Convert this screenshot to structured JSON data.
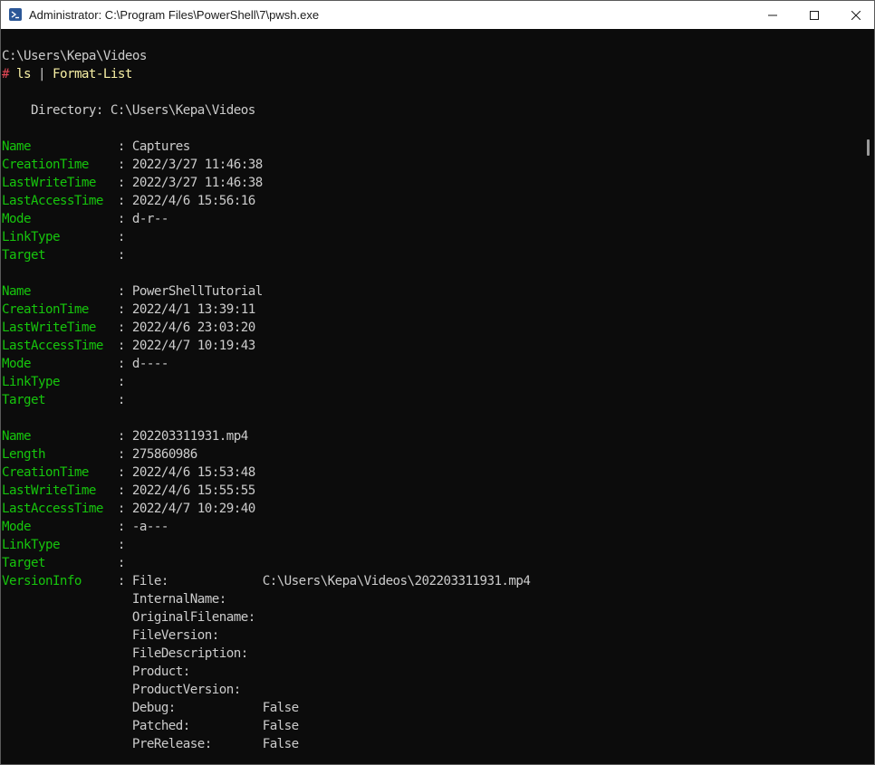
{
  "window": {
    "title": "Administrator: C:\\Program Files\\PowerShell\\7\\pwsh.exe",
    "icon": "powershell-icon",
    "controls": [
      "minimize-icon",
      "maximize-icon",
      "close-icon"
    ]
  },
  "colors": {
    "background": "#0c0c0c",
    "default_text": "#cccccc",
    "property_name": "#16c60c",
    "command": "#f9f1a5",
    "prompt_symbol": "#e74856",
    "titlebar": "#ffffff"
  },
  "terminal": {
    "lines": [
      {
        "row": 0,
        "spans": [
          {
            "t": "C:\\Users\\Kepa\\Videos",
            "c": "default",
            "name": "prompt-path"
          }
        ]
      },
      {
        "row": 1,
        "spans": [
          {
            "t": "#",
            "c": "red",
            "name": "prompt-symbol"
          },
          {
            "t": " ",
            "c": "default",
            "name": "prompt-space"
          },
          {
            "t": "ls",
            "c": "yellow",
            "name": "command-name"
          },
          {
            "t": " | ",
            "c": "default",
            "name": "pipe-operator"
          },
          {
            "t": "Format-List",
            "c": "yellow",
            "name": "command-name"
          }
        ]
      },
      {
        "row": 3,
        "spans": [
          {
            "t": "    Directory: C:\\Users\\Kepa\\Videos",
            "c": "default",
            "name": "directory-header"
          }
        ]
      },
      {
        "row": 5,
        "spans": [
          {
            "t": "Name           ",
            "c": "green",
            "name": "property-key"
          },
          {
            "t": " : ",
            "c": "default",
            "name": "property-separator"
          },
          {
            "t": "Captures",
            "c": "default",
            "name": "property-value"
          }
        ]
      },
      {
        "row": 6,
        "spans": [
          {
            "t": "CreationTime   ",
            "c": "green",
            "name": "property-key"
          },
          {
            "t": " : ",
            "c": "default",
            "name": "property-separator"
          },
          {
            "t": "2022/3/27 11:46:38",
            "c": "default",
            "name": "property-value"
          }
        ]
      },
      {
        "row": 7,
        "spans": [
          {
            "t": "LastWriteTime  ",
            "c": "green",
            "name": "property-key"
          },
          {
            "t": " : ",
            "c": "default",
            "name": "property-separator"
          },
          {
            "t": "2022/3/27 11:46:38",
            "c": "default",
            "name": "property-value"
          }
        ]
      },
      {
        "row": 8,
        "spans": [
          {
            "t": "LastAccessTime ",
            "c": "green",
            "name": "property-key"
          },
          {
            "t": " : ",
            "c": "default",
            "name": "property-separator"
          },
          {
            "t": "2022/4/6 15:56:16",
            "c": "default",
            "name": "property-value"
          }
        ]
      },
      {
        "row": 9,
        "spans": [
          {
            "t": "Mode           ",
            "c": "green",
            "name": "property-key"
          },
          {
            "t": " : ",
            "c": "default",
            "name": "property-separator"
          },
          {
            "t": "d-r--",
            "c": "default",
            "name": "property-value"
          }
        ]
      },
      {
        "row": 10,
        "spans": [
          {
            "t": "LinkType       ",
            "c": "green",
            "name": "property-key"
          },
          {
            "t": " : ",
            "c": "default",
            "name": "property-separator"
          }
        ]
      },
      {
        "row": 11,
        "spans": [
          {
            "t": "Target         ",
            "c": "green",
            "name": "property-key"
          },
          {
            "t": " : ",
            "c": "default",
            "name": "property-separator"
          }
        ]
      },
      {
        "row": 13,
        "spans": [
          {
            "t": "Name           ",
            "c": "green",
            "name": "property-key"
          },
          {
            "t": " : ",
            "c": "default",
            "name": "property-separator"
          },
          {
            "t": "PowerShellTutorial",
            "c": "default",
            "name": "property-value"
          }
        ]
      },
      {
        "row": 14,
        "spans": [
          {
            "t": "CreationTime   ",
            "c": "green",
            "name": "property-key"
          },
          {
            "t": " : ",
            "c": "default",
            "name": "property-separator"
          },
          {
            "t": "2022/4/1 13:39:11",
            "c": "default",
            "name": "property-value"
          }
        ]
      },
      {
        "row": 15,
        "spans": [
          {
            "t": "LastWriteTime  ",
            "c": "green",
            "name": "property-key"
          },
          {
            "t": " : ",
            "c": "default",
            "name": "property-separator"
          },
          {
            "t": "2022/4/6 23:03:20",
            "c": "default",
            "name": "property-value"
          }
        ]
      },
      {
        "row": 16,
        "spans": [
          {
            "t": "LastAccessTime ",
            "c": "green",
            "name": "property-key"
          },
          {
            "t": " : ",
            "c": "default",
            "name": "property-separator"
          },
          {
            "t": "2022/4/7 10:19:43",
            "c": "default",
            "name": "property-value"
          }
        ]
      },
      {
        "row": 17,
        "spans": [
          {
            "t": "Mode           ",
            "c": "green",
            "name": "property-key"
          },
          {
            "t": " : ",
            "c": "default",
            "name": "property-separator"
          },
          {
            "t": "d----",
            "c": "default",
            "name": "property-value"
          }
        ]
      },
      {
        "row": 18,
        "spans": [
          {
            "t": "LinkType       ",
            "c": "green",
            "name": "property-key"
          },
          {
            "t": " : ",
            "c": "default",
            "name": "property-separator"
          }
        ]
      },
      {
        "row": 19,
        "spans": [
          {
            "t": "Target         ",
            "c": "green",
            "name": "property-key"
          },
          {
            "t": " : ",
            "c": "default",
            "name": "property-separator"
          }
        ]
      },
      {
        "row": 21,
        "spans": [
          {
            "t": "Name           ",
            "c": "green",
            "name": "property-key"
          },
          {
            "t": " : ",
            "c": "default",
            "name": "property-separator"
          },
          {
            "t": "202203311931.mp4",
            "c": "default",
            "name": "property-value"
          }
        ]
      },
      {
        "row": 22,
        "spans": [
          {
            "t": "Length         ",
            "c": "green",
            "name": "property-key"
          },
          {
            "t": " : ",
            "c": "default",
            "name": "property-separator"
          },
          {
            "t": "275860986",
            "c": "default",
            "name": "property-value"
          }
        ]
      },
      {
        "row": 23,
        "spans": [
          {
            "t": "CreationTime   ",
            "c": "green",
            "name": "property-key"
          },
          {
            "t": " : ",
            "c": "default",
            "name": "property-separator"
          },
          {
            "t": "2022/4/6 15:53:48",
            "c": "default",
            "name": "property-value"
          }
        ]
      },
      {
        "row": 24,
        "spans": [
          {
            "t": "LastWriteTime  ",
            "c": "green",
            "name": "property-key"
          },
          {
            "t": " : ",
            "c": "default",
            "name": "property-separator"
          },
          {
            "t": "2022/4/6 15:55:55",
            "c": "default",
            "name": "property-value"
          }
        ]
      },
      {
        "row": 25,
        "spans": [
          {
            "t": "LastAccessTime ",
            "c": "green",
            "name": "property-key"
          },
          {
            "t": " : ",
            "c": "default",
            "name": "property-separator"
          },
          {
            "t": "2022/4/7 10:29:40",
            "c": "default",
            "name": "property-value"
          }
        ]
      },
      {
        "row": 26,
        "spans": [
          {
            "t": "Mode           ",
            "c": "green",
            "name": "property-key"
          },
          {
            "t": " : ",
            "c": "default",
            "name": "property-separator"
          },
          {
            "t": "-a---",
            "c": "default",
            "name": "property-value"
          }
        ]
      },
      {
        "row": 27,
        "spans": [
          {
            "t": "LinkType       ",
            "c": "green",
            "name": "property-key"
          },
          {
            "t": " : ",
            "c": "default",
            "name": "property-separator"
          }
        ]
      },
      {
        "row": 28,
        "spans": [
          {
            "t": "Target         ",
            "c": "green",
            "name": "property-key"
          },
          {
            "t": " : ",
            "c": "default",
            "name": "property-separator"
          }
        ]
      },
      {
        "row": 29,
        "spans": [
          {
            "t": "VersionInfo    ",
            "c": "green",
            "name": "property-key"
          },
          {
            "t": " : ",
            "c": "default",
            "name": "property-separator"
          },
          {
            "t": "File:             C:\\Users\\Kepa\\Videos\\202203311931.mp4",
            "c": "default",
            "name": "version-info-line"
          }
        ]
      },
      {
        "row": 30,
        "spans": [
          {
            "t": "                  InternalName:",
            "c": "default",
            "name": "version-info-line"
          }
        ]
      },
      {
        "row": 31,
        "spans": [
          {
            "t": "                  OriginalFilename:",
            "c": "default",
            "name": "version-info-line"
          }
        ]
      },
      {
        "row": 32,
        "spans": [
          {
            "t": "                  FileVersion:",
            "c": "default",
            "name": "version-info-line"
          }
        ]
      },
      {
        "row": 33,
        "spans": [
          {
            "t": "                  FileDescription:",
            "c": "default",
            "name": "version-info-line"
          }
        ]
      },
      {
        "row": 34,
        "spans": [
          {
            "t": "                  Product:",
            "c": "default",
            "name": "version-info-line"
          }
        ]
      },
      {
        "row": 35,
        "spans": [
          {
            "t": "                  ProductVersion:",
            "c": "default",
            "name": "version-info-line"
          }
        ]
      },
      {
        "row": 36,
        "spans": [
          {
            "t": "                  Debug:            False",
            "c": "default",
            "name": "version-info-line"
          }
        ]
      },
      {
        "row": 37,
        "spans": [
          {
            "t": "                  Patched:          False",
            "c": "default",
            "name": "version-info-line"
          }
        ]
      },
      {
        "row": 38,
        "spans": [
          {
            "t": "                  PreRelease:       False",
            "c": "default",
            "name": "version-info-line"
          }
        ]
      }
    ]
  }
}
